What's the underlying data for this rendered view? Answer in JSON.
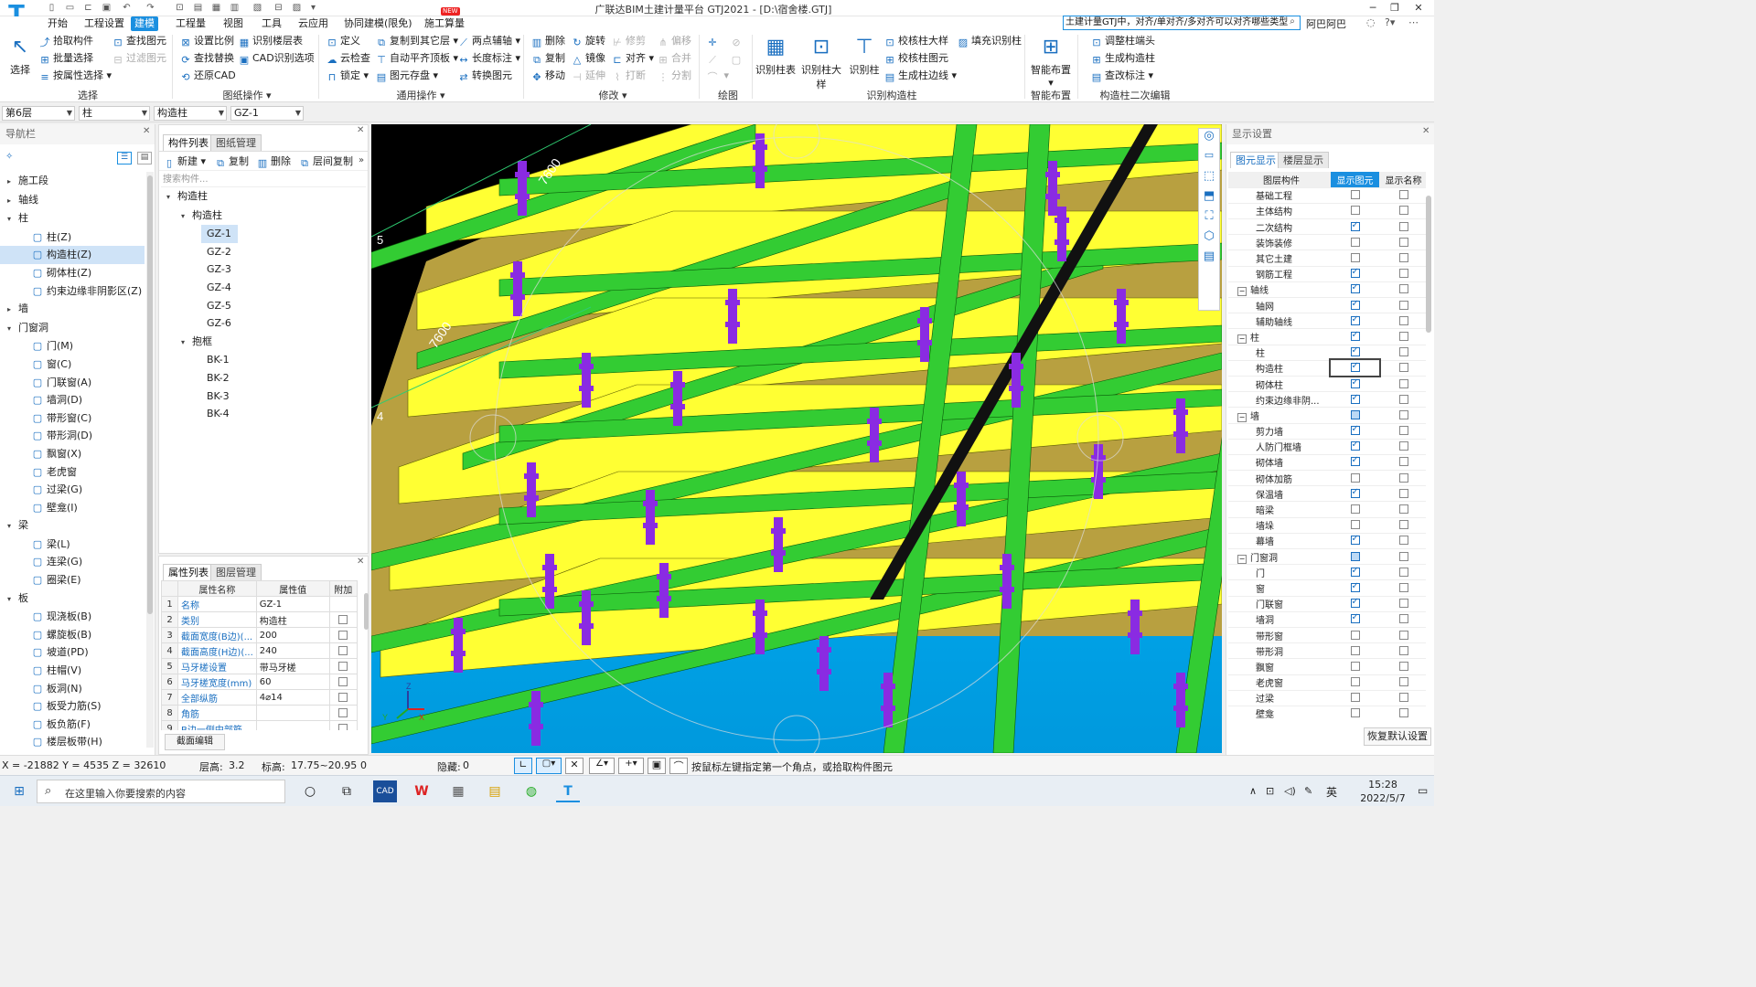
{
  "title": "广联达BIM土建计量平台 GTJ2021 - [D:\\宿舍楼.GTJ]",
  "menu": [
    "开始",
    "工程设置",
    "建模",
    "工程量",
    "视图",
    "工具",
    "云应用",
    "协同建模(限免)",
    "施工算量"
  ],
  "menu_active": "建模",
  "new_badge": "NEW",
  "search_text": "土建计量GTJ中，对齐/单对齐/多对齐可以对齐哪些类型",
  "username": "阿巴阿巴",
  "ribbon": {
    "select": {
      "big": "选择",
      "items": [
        "拾取构件",
        "批量选择",
        "按属性选择",
        "查找图元",
        "过滤图元"
      ],
      "label": "选择"
    },
    "drawing": {
      "items": [
        "设置比例",
        "查找替换",
        "还原CAD",
        "识别楼层表",
        "CAD识别选项"
      ],
      "label": "图纸操作"
    },
    "general": {
      "items": [
        "定义",
        "云检查",
        "锁定",
        "复制到其它层",
        "自动平齐顶板",
        "图元存盘",
        "两点辅轴",
        "长度标注",
        "转换图元"
      ],
      "label": "通用操作"
    },
    "modify": {
      "items": [
        "删除",
        "旋转",
        "修剪",
        "偏移",
        "复制",
        "镜像",
        "对齐",
        "合并",
        "移动",
        "延伸",
        "打断",
        "分割"
      ],
      "label": "修改"
    },
    "draw": {
      "label": "绘图"
    },
    "recog": {
      "big": [
        "识别柱表",
        "识别柱大样",
        "识别柱"
      ],
      "items": [
        "校核柱大样",
        "校核柱图元",
        "生成柱边线",
        "填充识别柱"
      ],
      "label": "识别构造柱"
    },
    "smart": {
      "big": "智能布置",
      "label": "智能布置"
    },
    "edit2": {
      "items": [
        "调整柱端头",
        "生成构造柱",
        "查改标注"
      ],
      "label": "构造柱二次编辑"
    }
  },
  "selectors": [
    "第6层",
    "柱",
    "构造柱",
    "GZ-1"
  ],
  "nav": {
    "title": "导航栏",
    "items": [
      {
        "t": "施工段",
        "lvl": 0,
        "arr": "▸"
      },
      {
        "t": "轴线",
        "lvl": 0,
        "arr": "▸"
      },
      {
        "t": "柱",
        "lvl": 0,
        "arr": "▾"
      },
      {
        "t": "柱(Z)",
        "lvl": 1,
        "icon": "柱"
      },
      {
        "t": "构造柱(Z)",
        "lvl": 1,
        "icon": "构",
        "sel": true
      },
      {
        "t": "砌体柱(Z)",
        "lvl": 1,
        "icon": "砌"
      },
      {
        "t": "约束边缘非阴影区(Z)",
        "lvl": 1,
        "icon": "约"
      },
      {
        "t": "墙",
        "lvl": 0,
        "arr": "▸"
      },
      {
        "t": "门窗洞",
        "lvl": 0,
        "arr": "▾"
      },
      {
        "t": "门(M)",
        "lvl": 1,
        "icon": "门"
      },
      {
        "t": "窗(C)",
        "lvl": 1,
        "icon": "窗"
      },
      {
        "t": "门联窗(A)",
        "lvl": 1,
        "icon": "联"
      },
      {
        "t": "墙洞(D)",
        "lvl": 1,
        "icon": "洞"
      },
      {
        "t": "带形窗(C)",
        "lvl": 1,
        "icon": "带"
      },
      {
        "t": "带形洞(D)",
        "lvl": 1,
        "icon": "形"
      },
      {
        "t": "飘窗(X)",
        "lvl": 1,
        "icon": "飘"
      },
      {
        "t": "老虎窗",
        "lvl": 1,
        "icon": "老"
      },
      {
        "t": "过梁(G)",
        "lvl": 1,
        "icon": "过"
      },
      {
        "t": "壁龛(I)",
        "lvl": 1,
        "icon": "龛"
      },
      {
        "t": "梁",
        "lvl": 0,
        "arr": "▾"
      },
      {
        "t": "梁(L)",
        "lvl": 1,
        "icon": "梁"
      },
      {
        "t": "连梁(G)",
        "lvl": 1,
        "icon": "连"
      },
      {
        "t": "圈梁(E)",
        "lvl": 1,
        "icon": "圈"
      },
      {
        "t": "板",
        "lvl": 0,
        "arr": "▾"
      },
      {
        "t": "现浇板(B)",
        "lvl": 1,
        "icon": "现"
      },
      {
        "t": "螺旋板(B)",
        "lvl": 1,
        "icon": "螺"
      },
      {
        "t": "坡道(PD)",
        "lvl": 1,
        "icon": "坡"
      },
      {
        "t": "柱帽(V)",
        "lvl": 1,
        "icon": "帽"
      },
      {
        "t": "板洞(N)",
        "lvl": 1,
        "icon": "板"
      },
      {
        "t": "板受力筋(S)",
        "lvl": 1,
        "icon": "受"
      },
      {
        "t": "板负筋(F)",
        "lvl": 1,
        "icon": "负"
      },
      {
        "t": "楼层板带(H)",
        "lvl": 1,
        "icon": "带"
      }
    ]
  },
  "comp": {
    "tabs": [
      "构件列表",
      "图纸管理"
    ],
    "toolbar": [
      "新建",
      "复制",
      "删除",
      "层间复制"
    ],
    "search_placeholder": "搜索构件...",
    "tree": [
      {
        "t": "构造柱",
        "lvl": 0,
        "arr": "▾"
      },
      {
        "t": "构造柱",
        "lvl": 1,
        "arr": "▾"
      },
      {
        "t": "GZ-1",
        "lvl": 2,
        "sel": true
      },
      {
        "t": "GZ-2",
        "lvl": 2
      },
      {
        "t": "GZ-3",
        "lvl": 2
      },
      {
        "t": "GZ-4",
        "lvl": 2
      },
      {
        "t": "GZ-5",
        "lvl": 2
      },
      {
        "t": "GZ-6",
        "lvl": 2
      },
      {
        "t": "抱框",
        "lvl": 1,
        "arr": "▾"
      },
      {
        "t": "BK-1",
        "lvl": 2
      },
      {
        "t": "BK-2",
        "lvl": 2
      },
      {
        "t": "BK-3",
        "lvl": 2
      },
      {
        "t": "BK-4",
        "lvl": 2
      }
    ]
  },
  "props": {
    "tabs": [
      "属性列表",
      "图层管理"
    ],
    "headers": [
      "属性名称",
      "属性值",
      "附加"
    ],
    "rows": [
      {
        "n": "1",
        "k": "名称",
        "v": "GZ-1"
      },
      {
        "n": "2",
        "k": "类别",
        "v": "构造柱"
      },
      {
        "n": "3",
        "k": "截面宽度(B边)(...",
        "v": "200"
      },
      {
        "n": "4",
        "k": "截面高度(H边)(...",
        "v": "240"
      },
      {
        "n": "5",
        "k": "马牙槎设置",
        "v": "带马牙槎"
      },
      {
        "n": "6",
        "k": "马牙槎宽度(mm)",
        "v": "60"
      },
      {
        "n": "7",
        "k": "全部纵筋",
        "v": "4⌀14"
      },
      {
        "n": "8",
        "k": "角筋",
        "v": ""
      },
      {
        "n": "9",
        "k": "B边一侧中部筋",
        "v": ""
      }
    ],
    "edit_btn": "截面编辑"
  },
  "viewport": {
    "dims": [
      "7600",
      "7600"
    ],
    "axes": [
      "5",
      "4"
    ]
  },
  "display": {
    "title": "显示设置",
    "tabs": [
      "图元显示",
      "楼层显示"
    ],
    "headers": [
      "图层构件",
      "显示图元",
      "显示名称"
    ],
    "rows": [
      {
        "t": "基础工程",
        "lvl": 1,
        "a": 0,
        "b": 0
      },
      {
        "t": "主体结构",
        "lvl": 1,
        "a": 0,
        "b": 0
      },
      {
        "t": "二次结构",
        "lvl": 1,
        "a": 1,
        "b": 0
      },
      {
        "t": "装饰装修",
        "lvl": 1,
        "a": 0,
        "b": 0
      },
      {
        "t": "其它土建",
        "lvl": 1,
        "a": 0,
        "b": 0
      },
      {
        "t": "钢筋工程",
        "lvl": 1,
        "a": 1,
        "b": 0
      },
      {
        "t": "轴线",
        "lvl": 0,
        "a": 1,
        "b": 0
      },
      {
        "t": "轴网",
        "lvl": 1,
        "a": 1,
        "b": 0
      },
      {
        "t": "辅助轴线",
        "lvl": 1,
        "a": 1,
        "b": 0
      },
      {
        "t": "柱",
        "lvl": 0,
        "a": 1,
        "b": 0
      },
      {
        "t": "柱",
        "lvl": 1,
        "a": 1,
        "b": 0
      },
      {
        "t": "构造柱",
        "lvl": 1,
        "a": 1,
        "b": 0
      },
      {
        "t": "砌体柱",
        "lvl": 1,
        "a": 1,
        "b": 0
      },
      {
        "t": "约束边缘非阴...",
        "lvl": 1,
        "a": 1,
        "b": 0
      },
      {
        "t": "墙",
        "lvl": 0,
        "a": 2,
        "b": 0
      },
      {
        "t": "剪力墙",
        "lvl": 1,
        "a": 1,
        "b": 0
      },
      {
        "t": "人防门框墙",
        "lvl": 1,
        "a": 1,
        "b": 0
      },
      {
        "t": "砌体墙",
        "lvl": 1,
        "a": 1,
        "b": 0
      },
      {
        "t": "砌体加筋",
        "lvl": 1,
        "a": 0,
        "b": 0
      },
      {
        "t": "保温墙",
        "lvl": 1,
        "a": 1,
        "b": 0
      },
      {
        "t": "暗梁",
        "lvl": 1,
        "a": 0,
        "b": 0
      },
      {
        "t": "墙垛",
        "lvl": 1,
        "a": 0,
        "b": 0
      },
      {
        "t": "幕墙",
        "lvl": 1,
        "a": 1,
        "b": 0
      },
      {
        "t": "门窗洞",
        "lvl": 0,
        "a": 2,
        "b": 0
      },
      {
        "t": "门",
        "lvl": 1,
        "a": 1,
        "b": 0
      },
      {
        "t": "窗",
        "lvl": 1,
        "a": 1,
        "b": 0
      },
      {
        "t": "门联窗",
        "lvl": 1,
        "a": 1,
        "b": 0
      },
      {
        "t": "墙洞",
        "lvl": 1,
        "a": 1,
        "b": 0
      },
      {
        "t": "带形窗",
        "lvl": 1,
        "a": 0,
        "b": 0
      },
      {
        "t": "带形洞",
        "lvl": 1,
        "a": 0,
        "b": 0
      },
      {
        "t": "飘窗",
        "lvl": 1,
        "a": 0,
        "b": 0
      },
      {
        "t": "老虎窗",
        "lvl": 1,
        "a": 0,
        "b": 0
      },
      {
        "t": "过梁",
        "lvl": 1,
        "a": 0,
        "b": 0
      },
      {
        "t": "壁龛",
        "lvl": 1,
        "a": 0,
        "b": 0
      }
    ],
    "reset_btn": "恢复默认设置"
  },
  "status": {
    "coords": "X = -21882 Y = 4535 Z = 32610",
    "floor_h_label": "层高:",
    "floor_h": "3.2",
    "elev_label": "标高:",
    "elev": "17.75~20.95",
    "zero": "0",
    "hidden_label": "隐藏:",
    "hidden": "0",
    "hint": "按鼠标左键指定第一个角点，或拾取构件图元"
  },
  "taskbar": {
    "search": "在这里输入你要搜索的内容",
    "time": "15:28",
    "date": "2022/5/7",
    "ime": "英"
  },
  "colors": {
    "accent": "#1a8fe0",
    "slab": "#ffff33",
    "beam": "#33cc33",
    "column": "#8a2be2",
    "wall": "#b8a040",
    "ground": "#00aaee"
  }
}
